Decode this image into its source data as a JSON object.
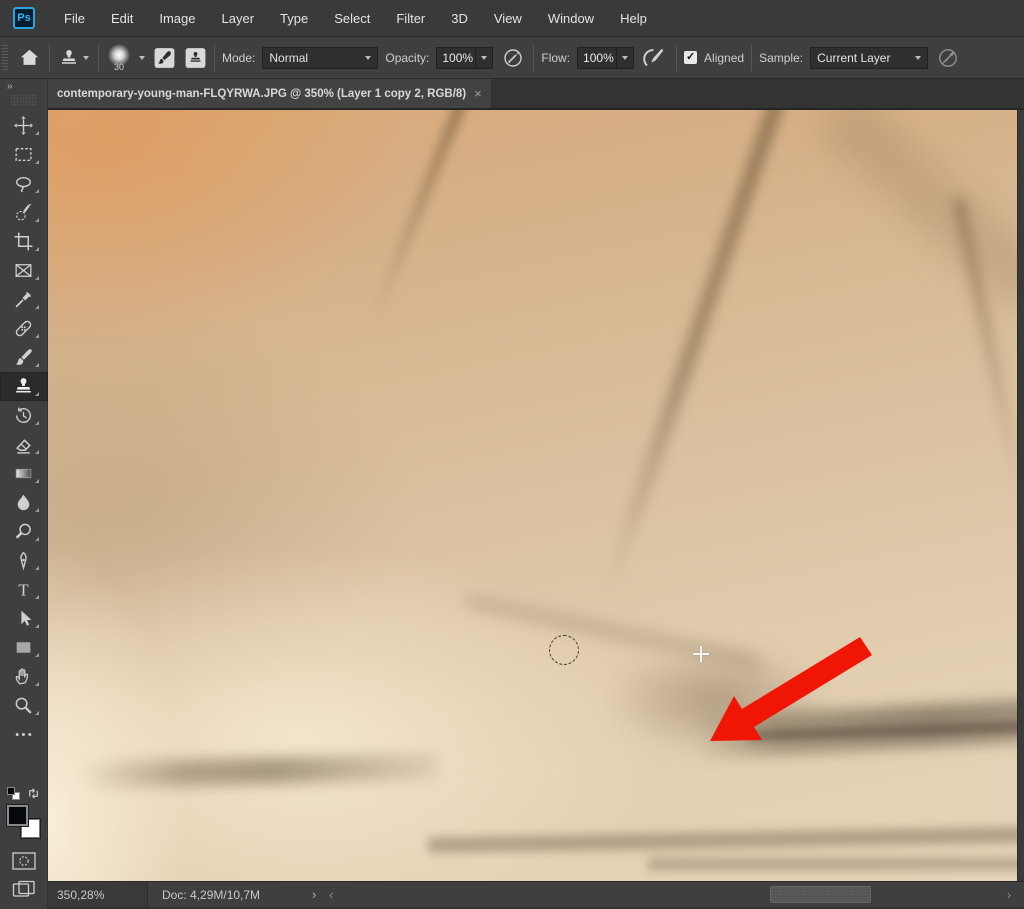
{
  "app": {
    "logo_text": "Ps"
  },
  "menu": {
    "items": [
      "File",
      "Edit",
      "Image",
      "Layer",
      "Type",
      "Select",
      "Filter",
      "3D",
      "View",
      "Window",
      "Help"
    ]
  },
  "options": {
    "brush_size": "30",
    "mode_label": "Mode:",
    "mode_value": "Normal",
    "opacity_label": "Opacity:",
    "opacity_value": "100%",
    "flow_label": "Flow:",
    "flow_value": "100%",
    "aligned_label": "Aligned",
    "aligned_checked": true,
    "check_glyph": "✓",
    "sample_label": "Sample:",
    "sample_value": "Current Layer"
  },
  "tab": {
    "title": "contemporary-young-man-FLQYRWA.JPG @ 350% (Layer 1 copy 2, RGB/8)",
    "close_glyph": "×"
  },
  "toolbar": {
    "collapse_glyph": "»",
    "selected_tool": "clone-stamp",
    "tools": [
      "move",
      "marquee",
      "lasso",
      "quick-selection",
      "crop",
      "frame",
      "eyedropper",
      "healing-brush",
      "brush",
      "clone-stamp",
      "history-brush",
      "eraser",
      "gradient",
      "blur",
      "dodge",
      "pen",
      "type",
      "path-selection",
      "rectangle",
      "hand",
      "zoom",
      "ellipsis"
    ]
  },
  "status": {
    "zoom_value": "350,28%",
    "doc_label": "Doc: 4,29M/10,7M",
    "expand_glyph": "›",
    "scroll_left_glyph": "‹",
    "scroll_right_glyph": "›"
  },
  "annotation": {
    "arrow_color": "#f01505"
  },
  "colors": {
    "accent_blue": "#2fb6f3",
    "canvas_skin_tone": "#dcc2a2"
  }
}
